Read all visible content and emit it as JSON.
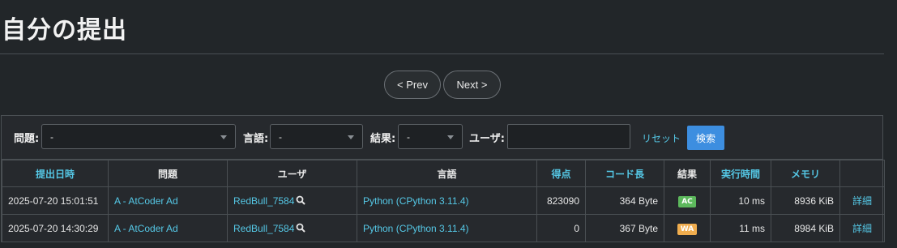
{
  "page": {
    "title": "自分の提出"
  },
  "pager": {
    "prev_label": "< Prev",
    "next_label": "Next >"
  },
  "filters": {
    "problem": {
      "label": "問題:",
      "value": "-"
    },
    "language": {
      "label": "言語:",
      "value": "-"
    },
    "result": {
      "label": "結果:",
      "value": "-"
    },
    "user": {
      "label": "ユーザ:",
      "value": ""
    },
    "reset_label": "リセット",
    "search_label": "検索"
  },
  "table": {
    "headers": [
      "提出日時",
      "問題",
      "ユーザ",
      "言語",
      "得点",
      "コード長",
      "結果",
      "実行時間",
      "メモリ",
      ""
    ],
    "rows": [
      {
        "date": "2025-07-20 15:01:51",
        "problem": "A - AtCoder Ad",
        "user": "RedBull_7584",
        "language": "Python (CPython 3.11.4)",
        "score": "823090",
        "code_length": "364 Byte",
        "result": "AC",
        "result_color": "#5cb85c",
        "time": "10 ms",
        "memory": "8936 KiB",
        "detail": "詳細"
      },
      {
        "date": "2025-07-20 14:30:29",
        "problem": "A - AtCoder Ad",
        "user": "RedBull_7584",
        "language": "Python (CPython 3.11.4)",
        "score": "0",
        "code_length": "367 Byte",
        "result": "WA",
        "result_color": "#f0ad4e",
        "time": "11 ms",
        "memory": "8984 KiB",
        "detail": "詳細"
      }
    ]
  },
  "colors": {
    "background": "#222629",
    "link": "#55c8e6",
    "accent": "#3d8ee0"
  }
}
